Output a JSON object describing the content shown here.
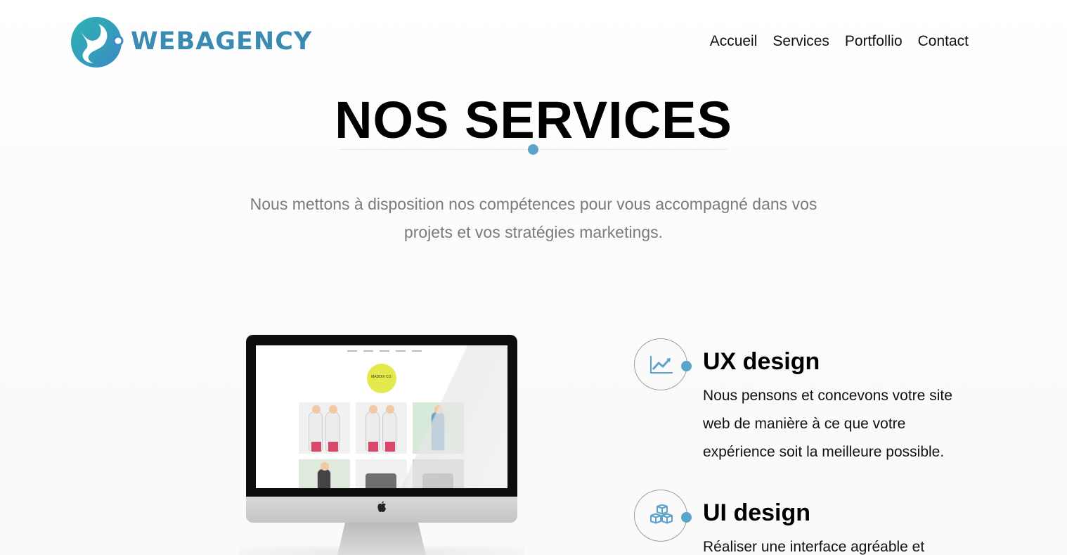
{
  "brand": {
    "name": "WEBAGENCY",
    "color": "#3a8bb2"
  },
  "nav": {
    "items": [
      "Accueil",
      "Services",
      "Portfollio",
      "Contact"
    ]
  },
  "hero": {
    "title": "NOS SERVICES",
    "intro": "Nous mettons à disposition nos compétences pour vous accompagné dans vos projets et vos stratégies marketings."
  },
  "monitor_preview": {
    "logo_text": "MADDIX CO."
  },
  "services": [
    {
      "title": "UX design",
      "icon": "trending-chart-icon",
      "description": "Nous pensons et concevons votre site web de manière à ce que votre expérience soit la meilleure possible."
    },
    {
      "title": "UI design",
      "icon": "cubes-icon",
      "description": "Réaliser une interface agréable et"
    }
  ],
  "colors": {
    "accent": "#5aa3cb",
    "text_muted": "#7b7b7b"
  }
}
